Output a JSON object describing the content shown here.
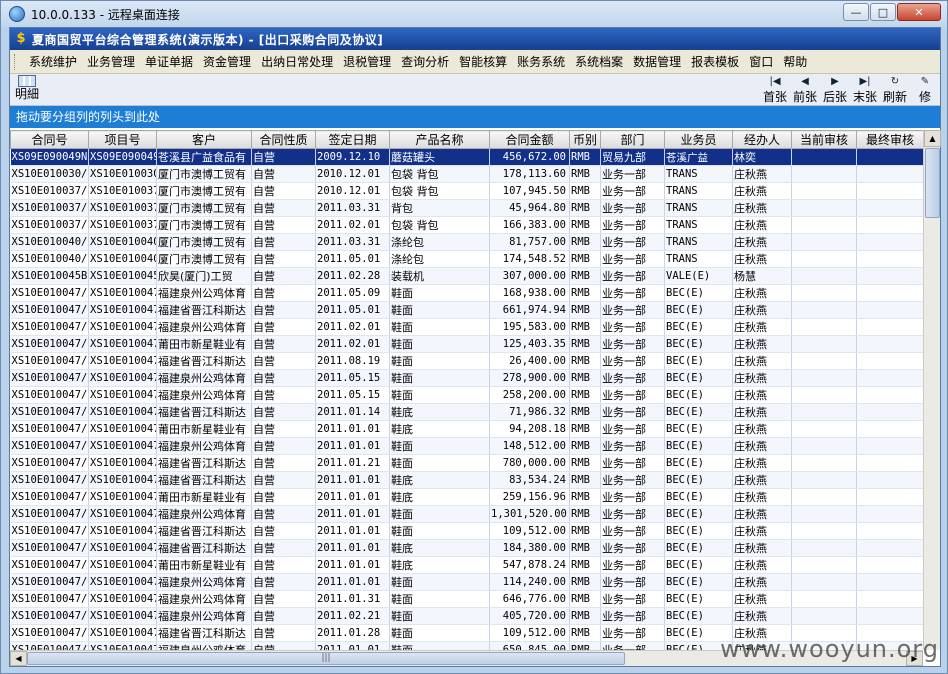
{
  "remote_window": {
    "title": "10.0.0.133 - 远程桌面连接",
    "controls": {
      "minimize": "—",
      "maximize": "□",
      "close": "✕"
    }
  },
  "app": {
    "title": "夏商国贸平台综合管理系统(演示版本) - [出口采购合同及协议]",
    "menu": [
      "系统维护",
      "业务管理",
      "单证单据",
      "资金管理",
      "出纳日常处理",
      "退税管理",
      "查询分析",
      "智能核算",
      "账务系统",
      "系统档案",
      "数据管理",
      "报表模板",
      "窗口",
      "帮助"
    ],
    "toolbar": {
      "left": {
        "label": "明細",
        "icon": "grid-detail-icon"
      },
      "right": [
        {
          "label": "首张",
          "icon": "first-record-icon",
          "glyph": "|◀"
        },
        {
          "label": "前张",
          "icon": "prev-record-icon",
          "glyph": "◀"
        },
        {
          "label": "后张",
          "icon": "next-record-icon",
          "glyph": "▶"
        },
        {
          "label": "末张",
          "icon": "last-record-icon",
          "glyph": "▶|"
        },
        {
          "label": "刷新",
          "icon": "refresh-icon",
          "glyph": "↻"
        },
        {
          "label": "修",
          "icon": "edit-icon",
          "glyph": "✎"
        }
      ]
    },
    "group_panel_text": "拖动要分组列的列头到此处",
    "grid": {
      "columns": [
        "合同号",
        "项目号",
        "客户",
        "合同性质",
        "签定日期",
        "产品名称",
        "合同金额",
        "币别",
        "部门",
        "业务员",
        "经办人",
        "当前审核",
        "最终审核"
      ],
      "rows": [
        [
          "XS09E090049N",
          "XS09E090049",
          "苍溪县广益食品有",
          "自营",
          "2009.12.10",
          "蘑菇罐头",
          "456,672.00",
          "RMB",
          "贸易九部",
          "苍溪广益",
          "林奕",
          "",
          ""
        ],
        [
          "XS10E010030/",
          "XS10E010030",
          "厦门市澳博工贸有",
          "自营",
          "2010.12.01",
          "包袋 背包",
          "178,113.60",
          "RMB",
          "业务一部",
          "TRANS",
          "庄秋燕",
          "",
          ""
        ],
        [
          "XS10E010037/",
          "XS10E010037",
          "厦门市澳博工贸有",
          "自营",
          "2010.12.01",
          "包袋 背包",
          "107,945.50",
          "RMB",
          "业务一部",
          "TRANS",
          "庄秋燕",
          "",
          ""
        ],
        [
          "XS10E010037/",
          "XS10E010037",
          "厦门市澳博工贸有",
          "自营",
          "2011.03.31",
          "背包",
          "45,964.80",
          "RMB",
          "业务一部",
          "TRANS",
          "庄秋燕",
          "",
          ""
        ],
        [
          "XS10E010037/",
          "XS10E010037",
          "厦门市澳博工贸有",
          "自营",
          "2011.02.01",
          "包袋 背包",
          "166,383.00",
          "RMB",
          "业务一部",
          "TRANS",
          "庄秋燕",
          "",
          ""
        ],
        [
          "XS10E010040/",
          "XS10E010040",
          "厦门市澳博工贸有",
          "自营",
          "2011.03.31",
          "涤纶包",
          "81,757.00",
          "RMB",
          "业务一部",
          "TRANS",
          "庄秋燕",
          "",
          ""
        ],
        [
          "XS10E010040/",
          "XS10E010040",
          "厦门市澳博工贸有",
          "自营",
          "2011.05.01",
          "涤纶包",
          "174,548.52",
          "RMB",
          "业务一部",
          "TRANS",
          "庄秋燕",
          "",
          ""
        ],
        [
          "XS10E010045B",
          "XS10E010045",
          "欣昊(厦门)工贸",
          "自营",
          "2011.02.28",
          "装载机",
          "307,000.00",
          "RMB",
          "业务一部",
          "VALE(E)",
          "杨慧",
          "",
          ""
        ],
        [
          "XS10E010047/",
          "XS10E010047",
          "福建泉州公鸡体育",
          "自营",
          "2011.05.09",
          "鞋面",
          "168,938.00",
          "RMB",
          "业务一部",
          "BEC(E)",
          "庄秋燕",
          "",
          ""
        ],
        [
          "XS10E010047/",
          "XS10E010047",
          "福建省晋江科斯达",
          "自营",
          "2011.05.01",
          "鞋面",
          "661,974.94",
          "RMB",
          "业务一部",
          "BEC(E)",
          "庄秋燕",
          "",
          ""
        ],
        [
          "XS10E010047/",
          "XS10E010047",
          "福建泉州公鸡体育",
          "自营",
          "2011.02.01",
          "鞋面",
          "195,583.00",
          "RMB",
          "业务一部",
          "BEC(E)",
          "庄秋燕",
          "",
          ""
        ],
        [
          "XS10E010047/",
          "XS10E010047",
          "莆田市新星鞋业有",
          "自营",
          "2011.02.01",
          "鞋面",
          "125,403.35",
          "RMB",
          "业务一部",
          "BEC(E)",
          "庄秋燕",
          "",
          ""
        ],
        [
          "XS10E010047/",
          "XS10E010047",
          "福建省晋江科斯达",
          "自营",
          "2011.08.19",
          "鞋面",
          "26,400.00",
          "RMB",
          "业务一部",
          "BEC(E)",
          "庄秋燕",
          "",
          ""
        ],
        [
          "XS10E010047/",
          "XS10E010047",
          "福建泉州公鸡体育",
          "自营",
          "2011.05.15",
          "鞋面",
          "278,900.00",
          "RMB",
          "业务一部",
          "BEC(E)",
          "庄秋燕",
          "",
          ""
        ],
        [
          "XS10E010047/",
          "XS10E010047",
          "福建泉州公鸡体育",
          "自营",
          "2011.05.15",
          "鞋面",
          "258,200.00",
          "RMB",
          "业务一部",
          "BEC(E)",
          "庄秋燕",
          "",
          ""
        ],
        [
          "XS10E010047/",
          "XS10E010047",
          "福建省晋江科斯达",
          "自营",
          "2011.01.14",
          "鞋底",
          "71,986.32",
          "RMB",
          "业务一部",
          "BEC(E)",
          "庄秋燕",
          "",
          ""
        ],
        [
          "XS10E010047/",
          "XS10E010047",
          "莆田市新星鞋业有",
          "自营",
          "2011.01.01",
          "鞋底",
          "94,208.18",
          "RMB",
          "业务一部",
          "BEC(E)",
          "庄秋燕",
          "",
          ""
        ],
        [
          "XS10E010047/",
          "XS10E010047",
          "福建泉州公鸡体育",
          "自营",
          "2011.01.01",
          "鞋面",
          "148,512.00",
          "RMB",
          "业务一部",
          "BEC(E)",
          "庄秋燕",
          "",
          ""
        ],
        [
          "XS10E010047/",
          "XS10E010047",
          "福建省晋江科斯达",
          "自营",
          "2011.01.21",
          "鞋面",
          "780,000.00",
          "RMB",
          "业务一部",
          "BEC(E)",
          "庄秋燕",
          "",
          ""
        ],
        [
          "XS10E010047/",
          "XS10E010047",
          "福建省晋江科斯达",
          "自营",
          "2011.01.01",
          "鞋底",
          "83,534.24",
          "RMB",
          "业务一部",
          "BEC(E)",
          "庄秋燕",
          "",
          ""
        ],
        [
          "XS10E010047/",
          "XS10E010047",
          "莆田市新星鞋业有",
          "自营",
          "2011.01.01",
          "鞋底",
          "259,156.96",
          "RMB",
          "业务一部",
          "BEC(E)",
          "庄秋燕",
          "",
          ""
        ],
        [
          "XS10E010047/",
          "XS10E010047",
          "福建泉州公鸡体育",
          "自营",
          "2011.01.01",
          "鞋面",
          "1,301,520.00",
          "RMB",
          "业务一部",
          "BEC(E)",
          "庄秋燕",
          "",
          ""
        ],
        [
          "XS10E010047/",
          "XS10E010047",
          "福建省晋江科斯达",
          "自营",
          "2011.01.01",
          "鞋面",
          "109,512.00",
          "RMB",
          "业务一部",
          "BEC(E)",
          "庄秋燕",
          "",
          ""
        ],
        [
          "XS10E010047/",
          "XS10E010047",
          "福建省晋江科斯达",
          "自营",
          "2011.01.01",
          "鞋底",
          "184,380.00",
          "RMB",
          "业务一部",
          "BEC(E)",
          "庄秋燕",
          "",
          ""
        ],
        [
          "XS10E010047/",
          "XS10E010047",
          "莆田市新星鞋业有",
          "自营",
          "2011.01.01",
          "鞋底",
          "547,878.24",
          "RMB",
          "业务一部",
          "BEC(E)",
          "庄秋燕",
          "",
          ""
        ],
        [
          "XS10E010047/",
          "XS10E010047",
          "福建泉州公鸡体育",
          "自营",
          "2011.01.01",
          "鞋面",
          "114,240.00",
          "RMB",
          "业务一部",
          "BEC(E)",
          "庄秋燕",
          "",
          ""
        ],
        [
          "XS10E010047/",
          "XS10E010047",
          "福建泉州公鸡体育",
          "自营",
          "2011.01.31",
          "鞋面",
          "646,776.00",
          "RMB",
          "业务一部",
          "BEC(E)",
          "庄秋燕",
          "",
          ""
        ],
        [
          "XS10E010047/",
          "XS10E010047",
          "福建泉州公鸡体育",
          "自营",
          "2011.02.21",
          "鞋面",
          "405,720.00",
          "RMB",
          "业务一部",
          "BEC(E)",
          "庄秋燕",
          "",
          ""
        ],
        [
          "XS10E010047/",
          "XS10E010047",
          "福建省晋江科斯达",
          "自营",
          "2011.01.28",
          "鞋面",
          "109,512.00",
          "RMB",
          "业务一部",
          "BEC(E)",
          "庄秋燕",
          "",
          ""
        ],
        [
          "XS10E010047/",
          "XS10E010047",
          "福建泉州公鸡体育",
          "自营",
          "2011.01.01",
          "鞋面",
          "650,845.00",
          "RMB",
          "业务一部",
          "BEC(E)",
          "庄秋燕",
          "",
          ""
        ]
      ]
    }
  },
  "watermark": "www.wooyun.org",
  "colors": {
    "selection": "#12308a",
    "group_panel": "#1e7ed6",
    "app_title": "#163f8f"
  }
}
